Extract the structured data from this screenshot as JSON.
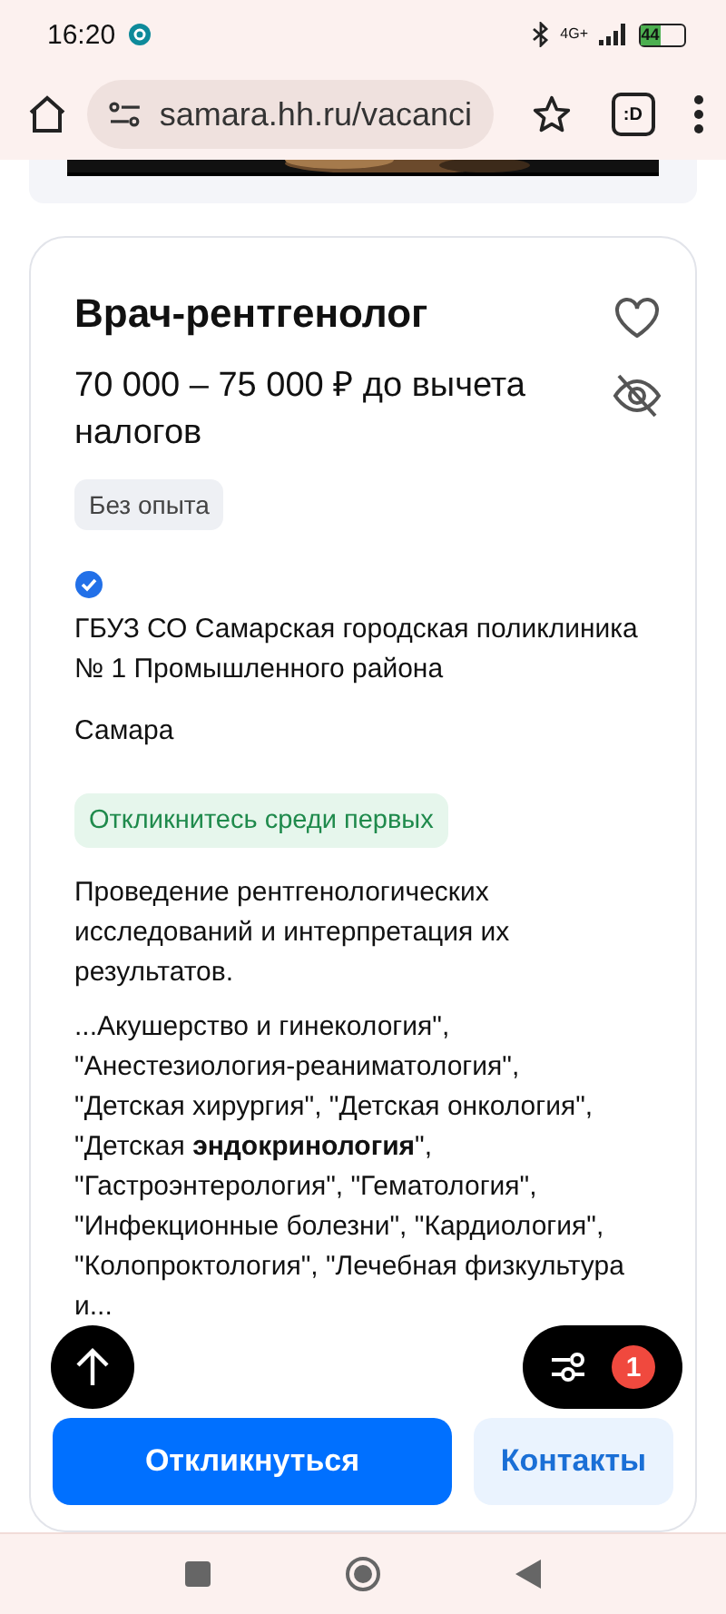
{
  "status_bar": {
    "time": "16:20",
    "network": "4G+",
    "battery": "44"
  },
  "browser": {
    "url": "samara.hh.ru/vacanci",
    "tab_label": ":D"
  },
  "vacancy": {
    "title": "Врач-рентгенолог",
    "salary": "70 000 – 75 000 ₽ до вычета налогов",
    "favorite": false,
    "experience": "Без опыта",
    "verified": true,
    "company": "ГБУЗ СО Самарская городская поликлиника № 1 Промышленного района",
    "city": "Самара",
    "badge": "Откликнитесь среди первых",
    "description": [
      "Проведение рентгенологических исследований и интерпретация их результатов.",
      "...Акушерство и гинекология\", \"Анестезиология-реаниматология\", \"Детская хирургия\", \"Детская онкология\", \"Детская **эндокринология**\", \"Гастроэнтерология\", \"Гематология\", \"Инфекционные болезни\", \"Кардиология\", \"Колопроктология\", \"Лечебная физкультура и..."
    ],
    "buttons": [
      {
        "label": "Откликнуться",
        "kind": "primary"
      },
      {
        "label": "Контакты",
        "kind": "secondary"
      }
    ]
  },
  "filter_fab": {
    "count": "1"
  }
}
